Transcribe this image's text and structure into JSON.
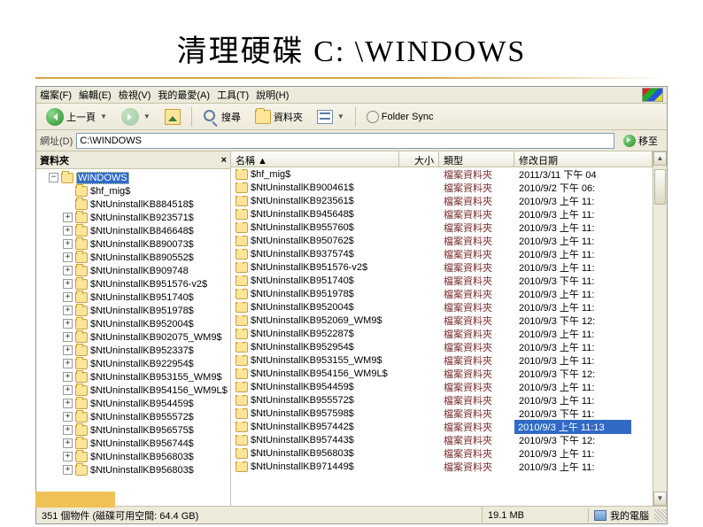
{
  "slide": {
    "title": "清理硬碟 C: \\WINDOWS"
  },
  "menubar": {
    "file": "檔案(F)",
    "edit": "編輯(E)",
    "view": "檢視(V)",
    "favorites": "我的最愛(A)",
    "tools": "工具(T)",
    "help": "說明(H)"
  },
  "toolbar": {
    "back": "上一頁",
    "search": "搜尋",
    "folders": "資料夾",
    "sync": "Folder Sync"
  },
  "addressbar": {
    "label": "網址(D)",
    "value": "C:\\WINDOWS",
    "go": "移至"
  },
  "folderpane": {
    "title": "資料夾",
    "close": "×",
    "root": "WINDOWS",
    "items": [
      "$hf_mig$",
      "$NtUninstallKB884518$",
      "$NtUninstallKB923571$",
      "$NtUninstallKB846648$",
      "$NtUninstallKB890073$",
      "$NtUninstallKB890552$",
      "$NtUninstallKB909748",
      "$NtUninstallKB951576-v2$",
      "$NtUninstallKB951740$",
      "$NtUninstallKB951978$",
      "$NtUninstallKB952004$",
      "$NtUninstallKB902075_WM9$",
      "$NtUninstallKB952337$",
      "$NtUninstallKB922954$",
      "$NtUninstallKB953155_WM9$",
      "$NtUninstallKB954156_WM9L$",
      "$NtUninstallKB954459$",
      "$NtUninstallKB955572$",
      "$NtUninstallKB956575$",
      "$NtUninstallKB956744$",
      "$NtUninstallKB956803$",
      "$NtUninstallKB956803$"
    ]
  },
  "listview": {
    "columns": {
      "name": "名稱 ▲",
      "size": "大小",
      "type": "類型",
      "date": "修改日期"
    },
    "rows": [
      {
        "name": "$hf_mig$",
        "type": "檔案資料夾",
        "date": "2011/3/11 下午 04"
      },
      {
        "name": "$NtUninstallKB900461$",
        "type": "檔案資料夾",
        "date": "2010/9/2 下午 06:"
      },
      {
        "name": "$NtUninstallKB923561$",
        "type": "檔案資料夾",
        "date": "2010/9/3 上午 11:"
      },
      {
        "name": "$NtUninstallKB945648$",
        "type": "檔案資料夾",
        "date": "2010/9/3 上午 11:"
      },
      {
        "name": "$NtUninstallKB955760$",
        "type": "檔案資料夾",
        "date": "2010/9/3 上午 11:"
      },
      {
        "name": "$NtUninstallKB950762$",
        "type": "檔案資料夾",
        "date": "2010/9/3 上午 11:"
      },
      {
        "name": "$NtUninstallKB937574$",
        "type": "檔案資料夾",
        "date": "2010/9/3 上午 11:"
      },
      {
        "name": "$NtUninstallKB951576-v2$",
        "type": "檔案資料夾",
        "date": "2010/9/3 上午 11:"
      },
      {
        "name": "$NtUninstallKB951740$",
        "type": "檔案資料夾",
        "date": "2010/9/3 下午 11:"
      },
      {
        "name": "$NtUninstallKB951978$",
        "type": "檔案資料夾",
        "date": "2010/9/3 上午 11:"
      },
      {
        "name": "$NtUninstallKB952004$",
        "type": "檔案資料夾",
        "date": "2010/9/3 上午 11:"
      },
      {
        "name": "$NtUninstallKB952069_WM9$",
        "type": "檔案資料夾",
        "date": "2010/9/3 下午 12:"
      },
      {
        "name": "$NtUninstallKB952287$",
        "type": "檔案資料夾",
        "date": "2010/9/3 上午 11:"
      },
      {
        "name": "$NtUninstallKB952954$",
        "type": "檔案資料夾",
        "date": "2010/9/3 上午 11:"
      },
      {
        "name": "$NtUninstallKB953155_WM9$",
        "type": "檔案資料夾",
        "date": "2010/9/3 上午 11:"
      },
      {
        "name": "$NtUninstallKB954156_WM9L$",
        "type": "檔案資料夾",
        "date": "2010/9/3 下午 12:"
      },
      {
        "name": "$NtUninstallKB954459$",
        "type": "檔案資料夾",
        "date": "2010/9/3 上午 11:"
      },
      {
        "name": "$NtUninstallKB955572$",
        "type": "檔案資料夾",
        "date": "2010/9/3 上午 11:"
      },
      {
        "name": "$NtUninstallKB957598$",
        "type": "檔案資料夾",
        "date": "2010/9/3 下午 11:"
      },
      {
        "name": "$NtUninstallKB957442$",
        "type": "檔案資料夾",
        "date": "2010/9/3 上午 11:13",
        "highlight": true
      },
      {
        "name": "$NtUninstallKB957443$",
        "type": "檔案資料夾",
        "date": "2010/9/3 下午 12:"
      },
      {
        "name": "$NtUninstallKB956803$",
        "type": "檔案資料夾",
        "date": "2010/9/3 上午 11:"
      },
      {
        "name": "$NtUninstallKB971449$",
        "type": "檔案資料夾",
        "date": "2010/9/3 上午 11:"
      }
    ]
  },
  "statusbar": {
    "left": "351 個物件 (磁碟可用空間: 64.4 GB)",
    "mid": "19.1 MB",
    "right": "我的電腦"
  }
}
